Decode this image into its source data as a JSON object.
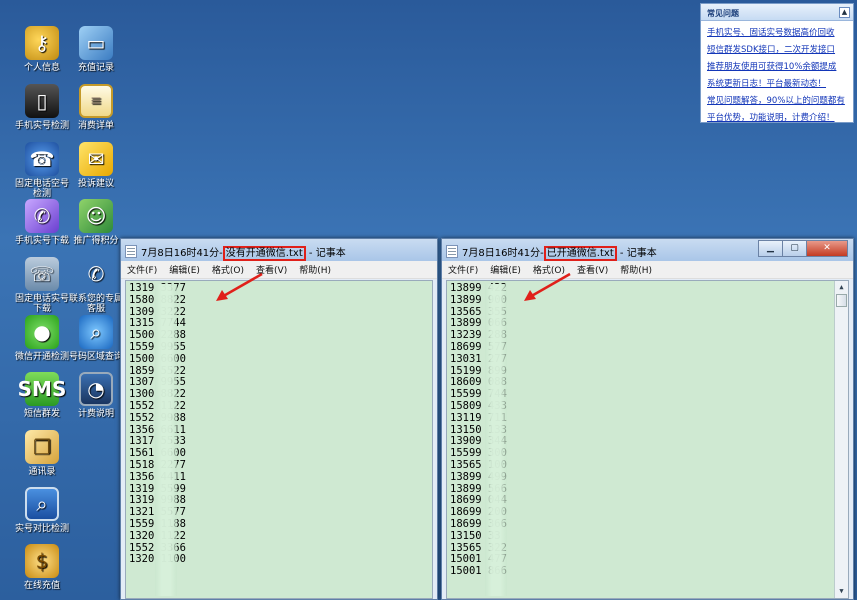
{
  "desktop": {
    "icons": [
      {
        "label": "个人信息",
        "icon": "key-icon"
      },
      {
        "label": "充值记录",
        "icon": "card-icon"
      },
      {
        "label": "手机实号检测",
        "icon": "phone-icon"
      },
      {
        "label": "消费详单",
        "icon": "clipboard-icon"
      },
      {
        "label": "固定电话空号检测",
        "icon": "telephone-icon"
      },
      {
        "label": "投诉建议",
        "icon": "mail-icon"
      },
      {
        "label": "手机实号下载",
        "icon": "mobile-icon"
      },
      {
        "label": "推广得积分",
        "icon": "promo-icon"
      },
      {
        "label": "固定电话实号下载",
        "icon": "fax-icon"
      },
      {
        "label": "联系您的专属客服",
        "icon": "support-phone-icon"
      },
      {
        "label": "微信开通检测",
        "icon": "wechat-icon"
      },
      {
        "label": "号码区域查询",
        "icon": "region-icon"
      },
      {
        "label": "短信群发",
        "icon": "sms-icon"
      },
      {
        "label": "计费说明",
        "icon": "billing-icon"
      },
      {
        "label": "通讯录",
        "icon": "address-book-icon"
      },
      {
        "label": "实号对比检测",
        "icon": "compare-search-icon"
      },
      {
        "label": "在线充值",
        "icon": "coins-icon"
      }
    ]
  },
  "faq": {
    "title": "常见问题",
    "toggle": "▲",
    "items": [
      "手机实号、固话实号数据高价回收",
      "短信群发SDK接口，二次开发接口",
      "推荐朋友使用可获得10%余额提成",
      "系统更新日志！平台最新动态！",
      "常见问题解答，90%以上的问题都有",
      "平台优势，功能说明，计费介绍！"
    ]
  },
  "window_left": {
    "title_prefix": "7月8日16时41分-",
    "title_file": "没有开通微信.txt",
    "title_suffix": " - 记事本",
    "menu": [
      "文件(F)",
      "编辑(E)",
      "格式(O)",
      "查看(V)",
      "帮助(H)"
    ],
    "lines": [
      "1319    3377",
      "1580    8822",
      "1309    3222",
      "1315    7744",
      "1500    2288",
      "1559    9955",
      "1500    6600",
      "1859    5522",
      "1307    9955",
      "1300    8822",
      "1552    1122",
      "1552    9988",
      "1356    6611",
      "1317    5533",
      "1561    6600",
      "1518    2277",
      "1356    4411",
      "1319    5599",
      "1319    9988",
      "1321    5577",
      "1559    1188",
      "1320    1122",
      "1552    3366",
      "1320    1100"
    ]
  },
  "window_right": {
    "title_prefix": "7月8日16时41分-",
    "title_file": "已开通微信.txt",
    "title_suffix": " - 记事本",
    "controls": [
      "minimize",
      "maximize",
      "close"
    ],
    "menu": [
      "文件(F)",
      "编辑(E)",
      "格式(O)",
      "查看(V)",
      "帮助(H)"
    ],
    "lines": [
      "13899    422",
      "13899    900",
      "13565    355",
      "13899    066",
      "13239    288",
      "18699    577",
      "13031    277",
      "15199    899",
      "18609    088",
      "15599    744",
      "15809    433",
      "13119    711",
      "13150    133",
      "13909    344",
      "15599    300",
      "13565    100",
      "13899    499",
      "13899    566",
      "18699    044",
      "18699    200",
      "18699    366",
      "13150    33",
      "13565    322",
      "15001    477",
      "15001    866"
    ]
  }
}
